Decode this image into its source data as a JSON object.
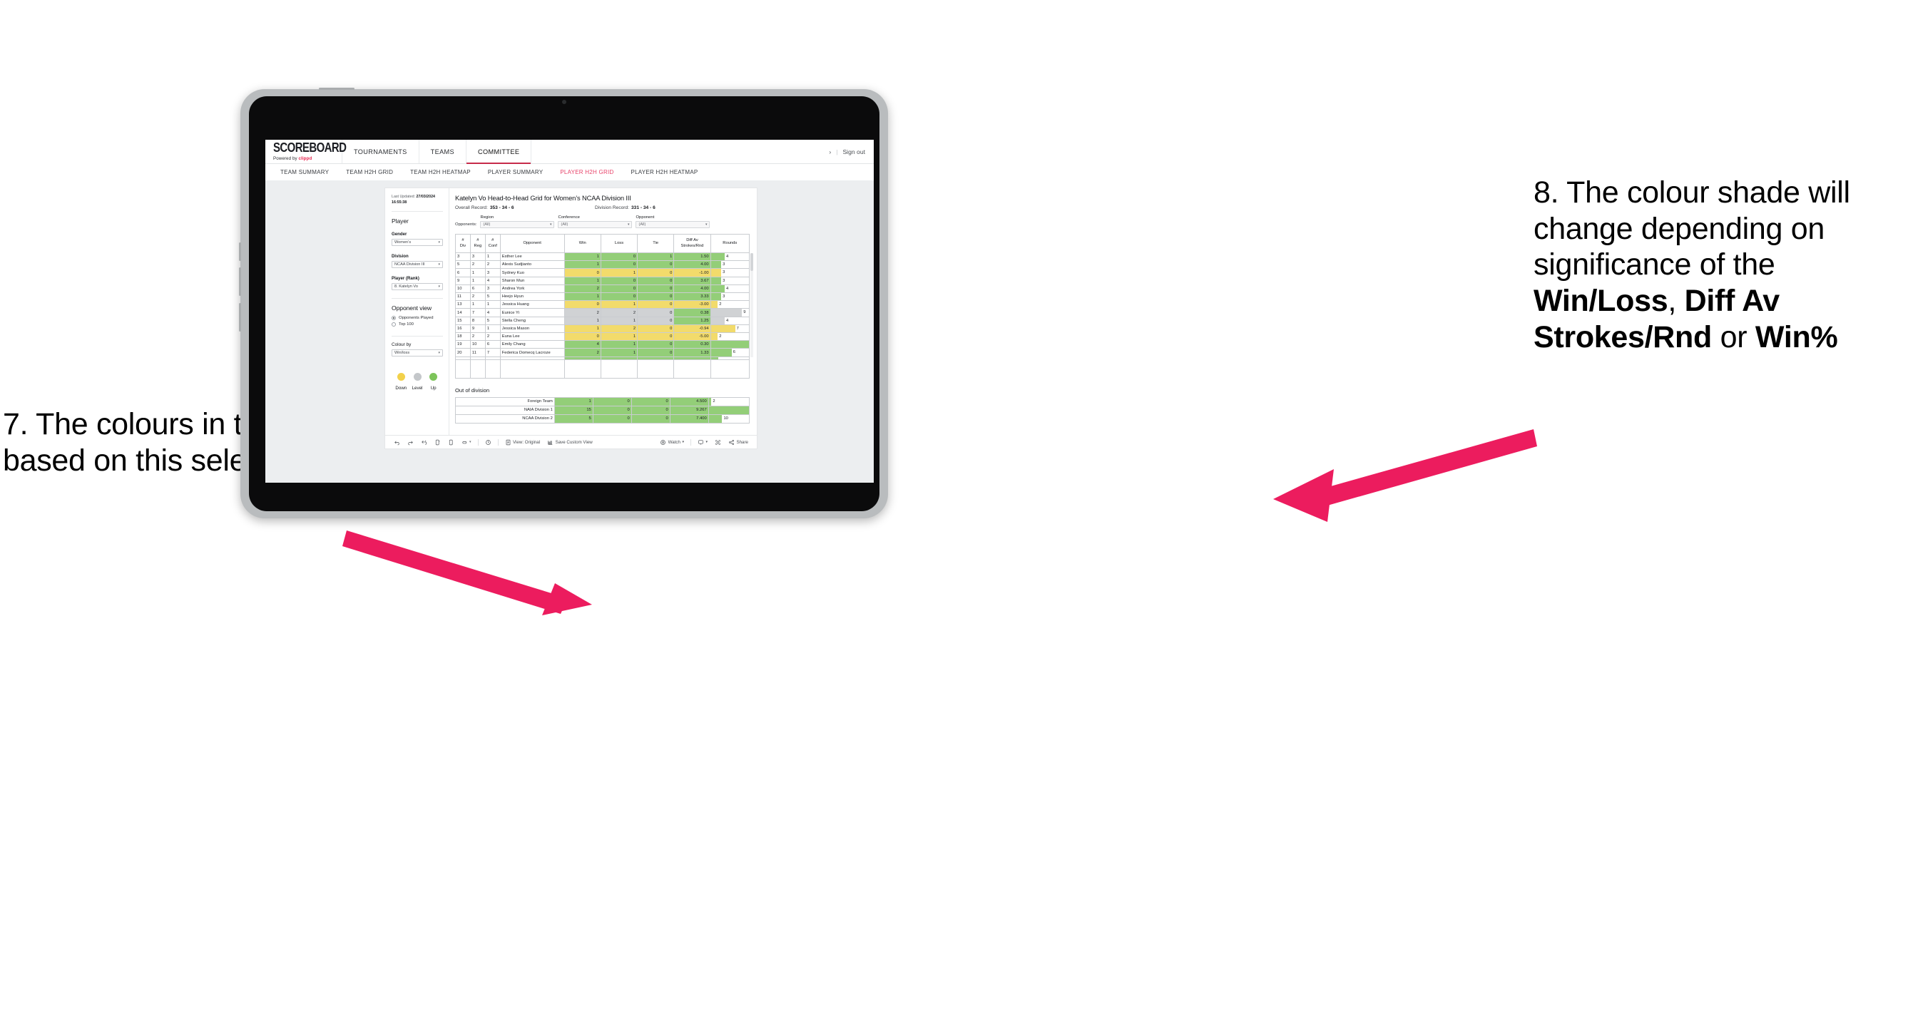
{
  "annotations": {
    "left": "7. The colours in the grid are based on this selection",
    "right_plain_1": "8. The colour shade will change depending on significance of the ",
    "right_bold_1": "Win/Loss",
    "right_plain_2": ", ",
    "right_bold_2": "Diff Av Strokes/Rnd",
    "right_plain_3": " or ",
    "right_bold_3": "Win%",
    "arrow_color": "#ec1c5e"
  },
  "app": {
    "brand": {
      "title": "SCOREBOARD",
      "powered_prefix": "Powered by ",
      "powered_name": "clippd"
    },
    "topnav": [
      {
        "label": "TOURNAMENTS",
        "active": false
      },
      {
        "label": "TEAMS",
        "active": false
      },
      {
        "label": "COMMITTEE",
        "active": true
      }
    ],
    "topnav_right": {
      "chevron": "›",
      "separator": "|",
      "signout": "Sign out"
    },
    "subnav": [
      {
        "label": "TEAM SUMMARY",
        "active": false
      },
      {
        "label": "TEAM H2H GRID",
        "active": false
      },
      {
        "label": "TEAM H2H HEATMAP",
        "active": false
      },
      {
        "label": "PLAYER SUMMARY",
        "active": false
      },
      {
        "label": "PLAYER H2H GRID",
        "active": true
      },
      {
        "label": "PLAYER H2H HEATMAP",
        "active": false
      }
    ],
    "accent": "#e8436a"
  },
  "panel": {
    "last_updated_label": "Last Updated: ",
    "last_updated_value": "27/03/2024 16:55:38",
    "heading": "Player",
    "gender": {
      "label": "Gender",
      "value": "Women’s"
    },
    "division": {
      "label": "Division",
      "value": "NCAA Division III"
    },
    "player_rank": {
      "label": "Player (Rank)",
      "value": "8. Katelyn Vo"
    },
    "opponent_view": {
      "heading": "Opponent view",
      "options": [
        {
          "label": "Opponents Played",
          "selected": true
        },
        {
          "label": "Top 100",
          "selected": false
        }
      ]
    },
    "colour_by": {
      "label": "Colour by",
      "value": "Win/loss"
    },
    "legend": [
      {
        "label": "Down",
        "color": "#f2d14b"
      },
      {
        "label": "Level",
        "color": "#c4c7ca"
      },
      {
        "label": "Up",
        "color": "#7dc45a"
      }
    ]
  },
  "viz": {
    "title": "Katelyn Vo Head-to-Head Grid for Women’s NCAA Division III",
    "overall_record_label": "Overall Record:",
    "overall_record_value": "353 -  34 - 6",
    "division_record_label": "Division Record:",
    "division_record_value": "331 -  34 - 6",
    "opponents_label": "Opponents:",
    "filters": [
      {
        "label": "Region",
        "value": "(All)"
      },
      {
        "label": "Conference",
        "value": "(All)"
      },
      {
        "label": "Opponent",
        "value": "(All)"
      }
    ]
  },
  "chart_data": {
    "type": "table",
    "title": "Katelyn Vo Head-to-Head Grid for Women’s NCAA Division III",
    "columns": [
      "# Div",
      "# Reg",
      "# Conf",
      "Opponent",
      "Win",
      "Loss",
      "Tie",
      "Diff Av Strokes/Rnd",
      "Rounds"
    ],
    "column_headers_multiline": [
      [
        "#",
        "Div"
      ],
      [
        "#",
        "Reg"
      ],
      [
        "#",
        "Conf"
      ],
      [
        "Opponent"
      ],
      [
        "Win"
      ],
      [
        "Loss"
      ],
      [
        "Tie"
      ],
      [
        "Diff Av",
        "Strokes/Rnd"
      ],
      [
        "Rounds"
      ]
    ],
    "rounds_max": 11,
    "rows": [
      {
        "div": "3",
        "reg": "3",
        "conf": "1",
        "opponent": "Esther Lee",
        "win": "1",
        "loss": "0",
        "tie": "1",
        "diff": "1.50",
        "rounds": "4",
        "state": "up"
      },
      {
        "div": "5",
        "reg": "2",
        "conf": "2",
        "opponent": "Alexis Sudjianto",
        "win": "1",
        "loss": "0",
        "tie": "0",
        "diff": "4.00",
        "rounds": "3",
        "state": "up"
      },
      {
        "div": "6",
        "reg": "1",
        "conf": "3",
        "opponent": "Sydney Kuo",
        "win": "0",
        "loss": "1",
        "tie": "0",
        "diff": "-1.00",
        "rounds": "3",
        "state": "down"
      },
      {
        "div": "9",
        "reg": "1",
        "conf": "4",
        "opponent": "Sharon Mun",
        "win": "1",
        "loss": "0",
        "tie": "0",
        "diff": "3.67",
        "rounds": "3",
        "state": "up"
      },
      {
        "div": "10",
        "reg": "6",
        "conf": "3",
        "opponent": "Andrea York",
        "win": "2",
        "loss": "0",
        "tie": "0",
        "diff": "4.00",
        "rounds": "4",
        "state": "up"
      },
      {
        "div": "11",
        "reg": "2",
        "conf": "5",
        "opponent": "Heejo Hyun",
        "win": "1",
        "loss": "0",
        "tie": "0",
        "diff": "3.33",
        "rounds": "3",
        "state": "up"
      },
      {
        "div": "13",
        "reg": "1",
        "conf": "1",
        "opponent": "Jessica Huang",
        "win": "0",
        "loss": "1",
        "tie": "0",
        "diff": "-3.00",
        "rounds": "2",
        "state": "down"
      },
      {
        "div": "14",
        "reg": "7",
        "conf": "4",
        "opponent": "Eunice Yi",
        "win": "2",
        "loss": "2",
        "tie": "0",
        "diff": "0.38",
        "rounds": "9",
        "state": "level",
        "diff_positive": true
      },
      {
        "div": "15",
        "reg": "8",
        "conf": "5",
        "opponent": "Stella Cheng",
        "win": "1",
        "loss": "1",
        "tie": "0",
        "diff": "1.25",
        "rounds": "4",
        "state": "level",
        "diff_positive": true
      },
      {
        "div": "16",
        "reg": "9",
        "conf": "1",
        "opponent": "Jessica Mason",
        "win": "1",
        "loss": "2",
        "tie": "0",
        "diff": "-0.94",
        "rounds": "7",
        "state": "down"
      },
      {
        "div": "18",
        "reg": "2",
        "conf": "2",
        "opponent": "Euna Lee",
        "win": "0",
        "loss": "1",
        "tie": "0",
        "diff": "-5.00",
        "rounds": "2",
        "state": "down"
      },
      {
        "div": "19",
        "reg": "10",
        "conf": "6",
        "opponent": "Emily Chang",
        "win": "4",
        "loss": "1",
        "tie": "0",
        "diff": "0.30",
        "rounds": "11",
        "state": "up"
      },
      {
        "div": "20",
        "reg": "11",
        "conf": "7",
        "opponent": "Federica Domecq Lacroze",
        "win": "2",
        "loss": "1",
        "tie": "0",
        "diff": "1.33",
        "rounds": "6",
        "state": "up"
      }
    ]
  },
  "out_of_division": {
    "title": "Out of division",
    "rounds_max": 30,
    "rows": [
      {
        "name": "Foreign Team",
        "win": "1",
        "loss": "0",
        "tie": "0",
        "diff": "4.500",
        "rounds": "2"
      },
      {
        "name": "NAIA Division 1",
        "win": "15",
        "loss": "0",
        "tie": "0",
        "diff": "9.267",
        "rounds": "30"
      },
      {
        "name": "NCAA Division 2",
        "win": "5",
        "loss": "0",
        "tie": "0",
        "diff": "7.400",
        "rounds": "10"
      }
    ]
  },
  "toolbar": {
    "items": [
      {
        "name": "undo-icon",
        "label": ""
      },
      {
        "name": "redo-icon",
        "label": ""
      },
      {
        "name": "revert-icon",
        "label": ""
      },
      {
        "name": "refresh-data-icon",
        "label": ""
      },
      {
        "name": "pause-updates-icon",
        "label": ""
      },
      {
        "name": "highlight-icon",
        "label": ""
      },
      {
        "name": "chevron-down-icon",
        "label": ""
      },
      {
        "name": "history-icon",
        "label": ""
      }
    ],
    "view_original": "View: Original",
    "save_custom_view": "Save Custom View",
    "watch": "Watch",
    "share": "Share",
    "watch_caret": "▾",
    "download_caret": "▾"
  }
}
